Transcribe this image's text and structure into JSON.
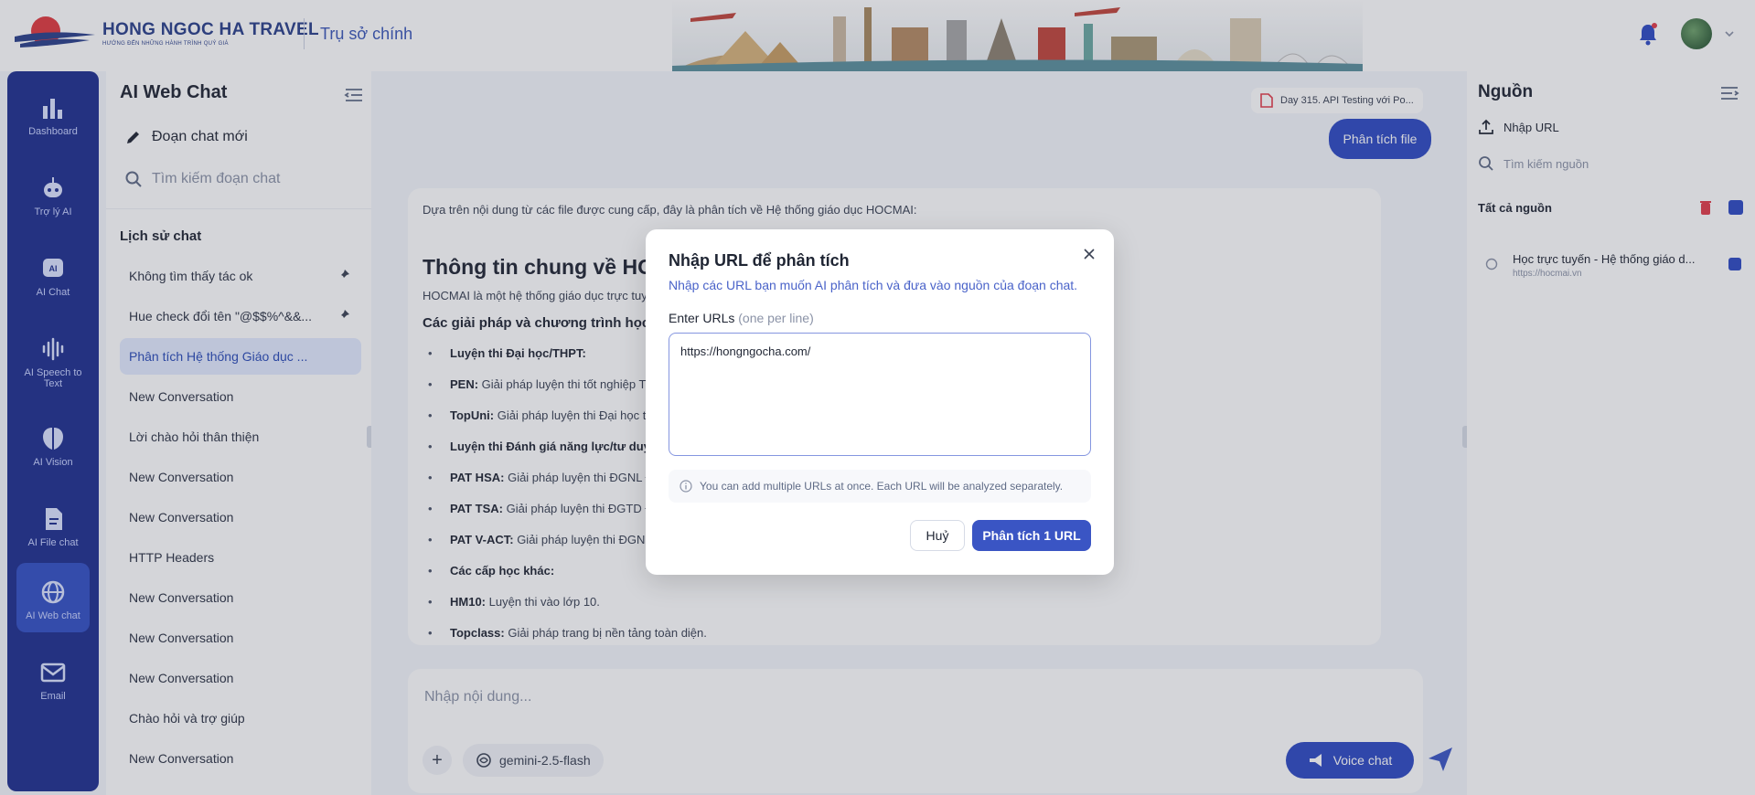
{
  "header": {
    "brand_name": "HONG NGOC HA TRAVEL",
    "brand_tagline": "HƯỚNG ĐẾN NHỮNG HÀNH TRÌNH QUÝ GIÁ",
    "branch": "Trụ sở chính"
  },
  "nav": [
    {
      "label": "Dashboard",
      "icon": "bar-chart-icon"
    },
    {
      "label": "Trợ lý AI",
      "icon": "robot-icon"
    },
    {
      "label": "AI Chat",
      "icon": "ai-chat-icon"
    },
    {
      "label": "AI Speech to Text",
      "icon": "waveform-icon"
    },
    {
      "label": "AI Vision",
      "icon": "brain-icon"
    },
    {
      "label": "AI File chat",
      "icon": "file-icon"
    },
    {
      "label": "AI Web chat",
      "icon": "globe-icon",
      "active": true
    },
    {
      "label": "Email",
      "icon": "mail-icon"
    }
  ],
  "chat_sidebar": {
    "title": "AI Web Chat",
    "new_chat": "Đoạn chat mới",
    "search_placeholder": "Tìm kiếm đoạn chat",
    "history_title": "Lịch sử chat",
    "items": [
      {
        "label": "Không tìm thấy tác ok",
        "pinned": true
      },
      {
        "label": "Hue check đổi tên \"@$$%^&&...",
        "pinned": true
      },
      {
        "label": "Phân tích Hệ thống Giáo dục ...",
        "active": true
      },
      {
        "label": "New Conversation"
      },
      {
        "label": "Lời chào hỏi thân thiện"
      },
      {
        "label": "New Conversation"
      },
      {
        "label": "New Conversation"
      },
      {
        "label": "HTTP Headers"
      },
      {
        "label": "New Conversation"
      },
      {
        "label": "New Conversation"
      },
      {
        "label": "New Conversation"
      },
      {
        "label": "Chào hỏi và trợ giúp"
      },
      {
        "label": "New Conversation"
      }
    ]
  },
  "main": {
    "file_chip": "Day 315. API Testing với Po...",
    "analyze_file_label": "Phân tích file",
    "answer": {
      "intro": "Dựa trên nội dung từ các file được cung cấp, đây là phân tích về Hệ thống giáo dục HOCMAI:",
      "heading": "Thông tin chung về HOCMAI",
      "desc": "HOCMAI là một hệ thống giáo dục trực tuyến cung cấp nhiều giải pháp học tập và luyện thi cho học sinh ở các cấp học khác nhau.",
      "solutions_title": "Các giải pháp và chương trình học:",
      "bullets": [
        {
          "strong": "Luyện thi Đại học/THPT:",
          "text": ""
        },
        {
          "strong": "PEN:",
          "text": " Giải pháp luyện thi tốt nghiệp THPT và Đại học."
        },
        {
          "strong": "TopUni:",
          "text": " Giải pháp luyện thi Đại học top đầu."
        },
        {
          "strong": "Luyện thi Đánh giá năng lực/tư duy:",
          "text": ""
        },
        {
          "strong": "PAT HSA:",
          "text": " Giải pháp luyện thi ĐGNL ĐHQG Hà Nội."
        },
        {
          "strong": "PAT TSA:",
          "text": " Giải pháp luyện thi ĐGTD ĐH Bách khoa."
        },
        {
          "strong": "PAT V-ACT:",
          "text": " Giải pháp luyện thi ĐGNL ĐHQG TP.HCM."
        },
        {
          "strong": "Các cấp học khác:",
          "text": ""
        },
        {
          "strong": "HM10:",
          "text": " Luyện thi vào lớp 10."
        },
        {
          "strong": "Topclass:",
          "text": " Giải pháp trang bị nền tảng toàn diện."
        }
      ]
    },
    "composer_placeholder": "Nhập nội dung...",
    "model": "gemini-2.5-flash",
    "voice_chat": "Voice chat"
  },
  "sources": {
    "title": "Nguồn",
    "import_url": "Nhập URL",
    "search_placeholder": "Tìm kiếm nguồn",
    "all_label": "Tất cả nguồn",
    "items": [
      {
        "name": "Học trực tuyến - Hệ thống giáo d...",
        "url": "https://hocmai.vn"
      }
    ]
  },
  "modal": {
    "title": "Nhập URL để phân tích",
    "subtitle": "Nhập các URL bạn muốn AI phân tích và đưa vào nguồn của đoạn chat.",
    "field_label": "Enter URLs",
    "field_hint": "(one per line)",
    "textarea_value": "https://hongngocha.com/",
    "info": "You can add multiple URLs at once. Each URL will be analyzed separately.",
    "cancel": "Huỷ",
    "submit": "Phân tích 1 URL"
  },
  "colors": {
    "nav_bg": "#1e2f8f",
    "accent": "#3a55c4",
    "active_chat_bg": "#e3ebff",
    "trash_red": "#e23b4a"
  }
}
